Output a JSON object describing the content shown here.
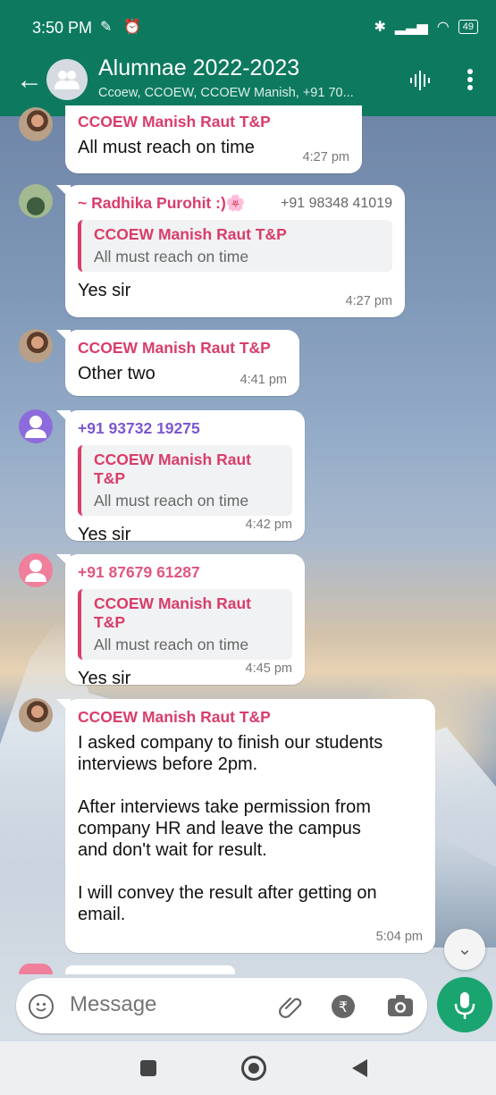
{
  "status_bar": {
    "time": "3:50 PM",
    "battery": "49"
  },
  "header": {
    "title": "Alumnae 2022-2023",
    "subtitle": "Ccoew, CCOEW, CCOEW Manish, +91 70..."
  },
  "messages": [
    {
      "sender": "CCOEW Manish Raut T&P",
      "sender_color": "#d93d6a",
      "text": "All must reach on time",
      "time": "4:27 pm"
    },
    {
      "sender": "~ Radhika Purohit :)🌸",
      "sender_phone": "+91 98348 41019",
      "sender_color": "#d93d6a",
      "quote_sender": "CCOEW Manish Raut T&P",
      "quote_text": "All must reach on time",
      "text": "Yes sir",
      "time": "4:27 pm"
    },
    {
      "sender": "CCOEW Manish Raut T&P",
      "sender_color": "#d93d6a",
      "text": "Other two",
      "time": "4:41 pm"
    },
    {
      "sender": "+91 93732 19275",
      "sender_color": "#7b57cf",
      "quote_sender": "CCOEW Manish Raut T&P",
      "quote_text": "All must reach on time",
      "text": "Yes sir",
      "time": "4:42 pm"
    },
    {
      "sender": "+91 87679 61287",
      "sender_color": "#e0577f",
      "quote_sender": "CCOEW Manish Raut T&P",
      "quote_text": "All must reach on time",
      "text": "Yes sir",
      "time": "4:45 pm"
    },
    {
      "sender": "CCOEW Manish Raut T&P",
      "sender_color": "#d93d6a",
      "text_lines": [
        "I asked company to finish our students",
        "interviews before 2pm.",
        "",
        "After interviews take permission from",
        "company HR and leave the campus",
        "and don't wait for result.",
        "",
        "I will convey the result after getting on",
        "email."
      ],
      "time": "5:04 pm"
    }
  ],
  "input": {
    "placeholder": "Message"
  },
  "colors": {
    "header": "#0d7a5f",
    "mic_button": "#1aa46f",
    "quote_bar": "#d93d6a"
  },
  "icons": [
    "back-arrow-icon",
    "group-avatar-icon",
    "voice-call-icon",
    "more-vert-icon",
    "emoji-icon",
    "attach-icon",
    "rupee-icon",
    "camera-icon",
    "mic-icon",
    "scroll-down-icon"
  ]
}
